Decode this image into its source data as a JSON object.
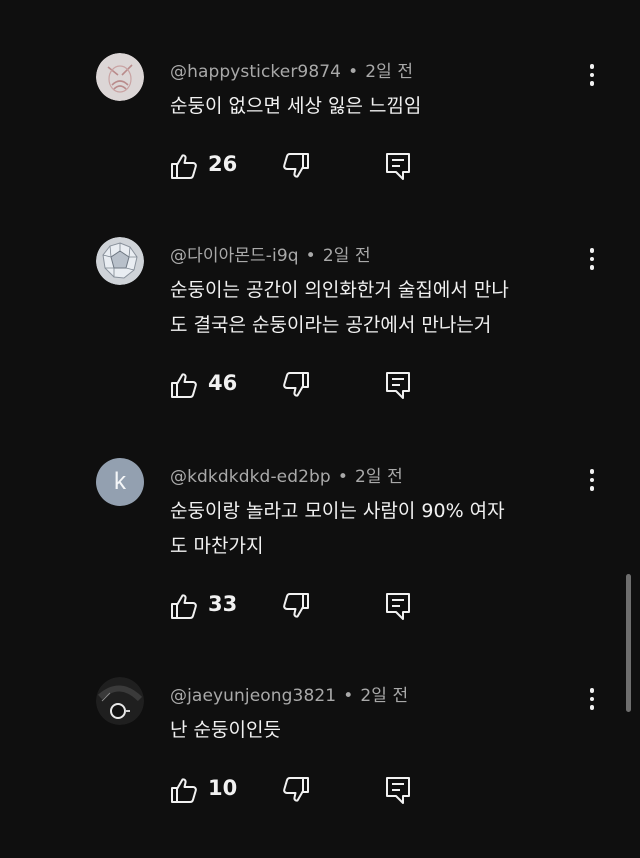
{
  "comments": [
    {
      "author": "@happysticker9874",
      "time": "2일 전",
      "avatar_type": "sticker-image",
      "lines": [
        "순둥이 없으면 세상 잃은 느낌임"
      ],
      "likes": "26"
    },
    {
      "author": "@다이아몬드-i9q",
      "time": "2일 전",
      "avatar_type": "diamond-image",
      "lines": [
        "순둥이는 공간이 의인화한거  술집에서 만나",
        "도 결국은 순둥이라는 공간에서 만나는거"
      ],
      "likes": "46"
    },
    {
      "author": "@kdkdkdkd-ed2bp",
      "time": "2일 전",
      "avatar_type": "letter",
      "avatar_letter": "k",
      "avatar_color": "#93a0b0",
      "lines": [
        "순둥이랑 놀라고 모이는 사람이 90% 여자",
        "도 마찬가지"
      ],
      "likes": "33"
    },
    {
      "author": "@jaeyunjeong3821",
      "time": "2일 전",
      "avatar_type": "dark-image",
      "lines": [
        "난 순둥이인듯"
      ],
      "likes": "10"
    }
  ],
  "meta_separator": "•",
  "icons": {
    "like": "thumbs-up-icon",
    "dislike": "thumbs-down-icon",
    "reply": "reply-comment-icon",
    "more": "vertical-ellipsis-icon"
  },
  "colors": {
    "background": "#0f0f0f",
    "text": "#f1f1f1",
    "meta": "#a9a9a9"
  }
}
